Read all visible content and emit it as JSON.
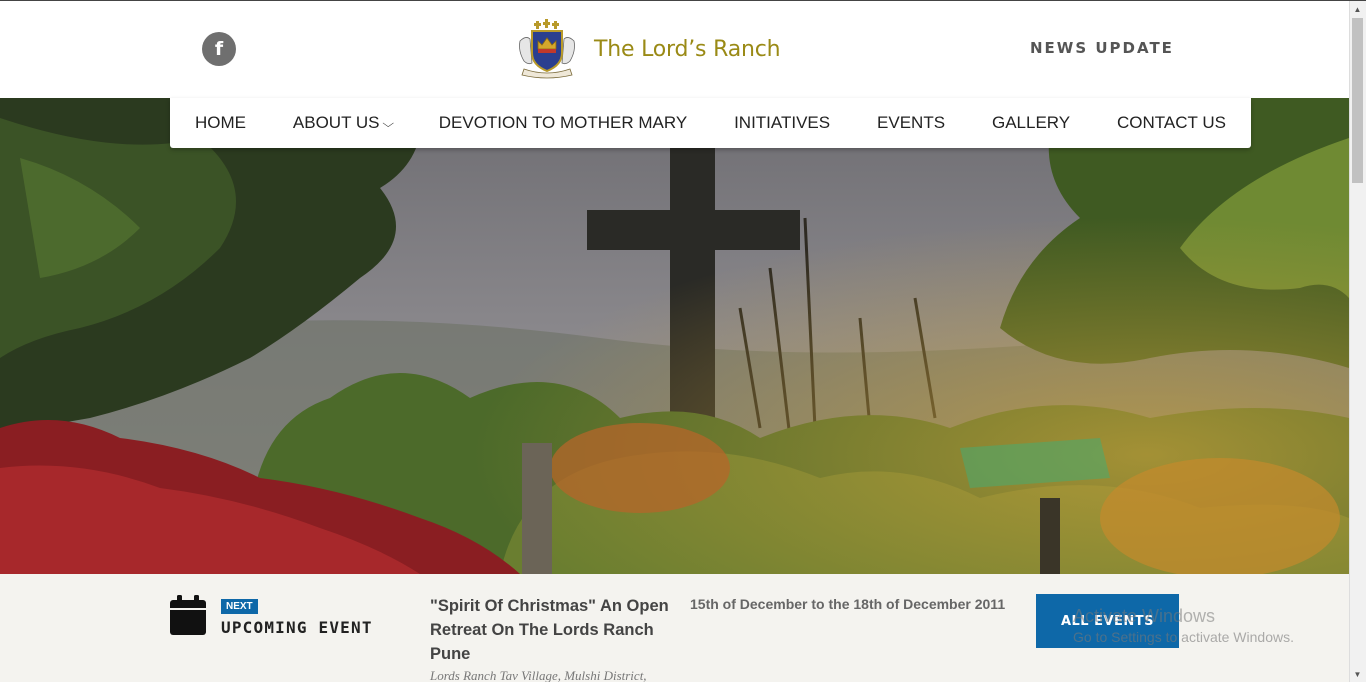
{
  "header": {
    "facebook_icon": "facebook-icon",
    "facebook_glyph": "f",
    "brand_name": "The Lord’s Ranch",
    "news_update": "NEWS UPDATE",
    "brand_color": "#9a8a16"
  },
  "nav": {
    "items": [
      {
        "label": "HOME"
      },
      {
        "label": "ABOUT US",
        "has_dropdown": true
      },
      {
        "label": "DEVOTION TO MOTHER MARY"
      },
      {
        "label": "INITIATIVES"
      },
      {
        "label": "EVENTS"
      },
      {
        "label": "GALLERY"
      },
      {
        "label": "CONTACT US"
      }
    ],
    "dropdown_glyph": "⌄"
  },
  "event": {
    "calendar_icon": "calendar-icon",
    "badge": "NEXT",
    "section_label": "UPCOMING EVENT",
    "title": "\"Spirit Of Christmas\" An Open Retreat On The Lords Ranch Pune",
    "location": "Lords Ranch Tav Village, Mulshi District,",
    "date": "15th of December to the 18th of December 2011",
    "all_events_label": "ALL EVENTS",
    "accent_color": "#0e68a8"
  },
  "watermark": {
    "line1": "Activate Windows",
    "line2": "Go to Settings to activate Windows."
  },
  "scrollbar": {
    "up_glyph": "▲",
    "down_glyph": "▼"
  }
}
